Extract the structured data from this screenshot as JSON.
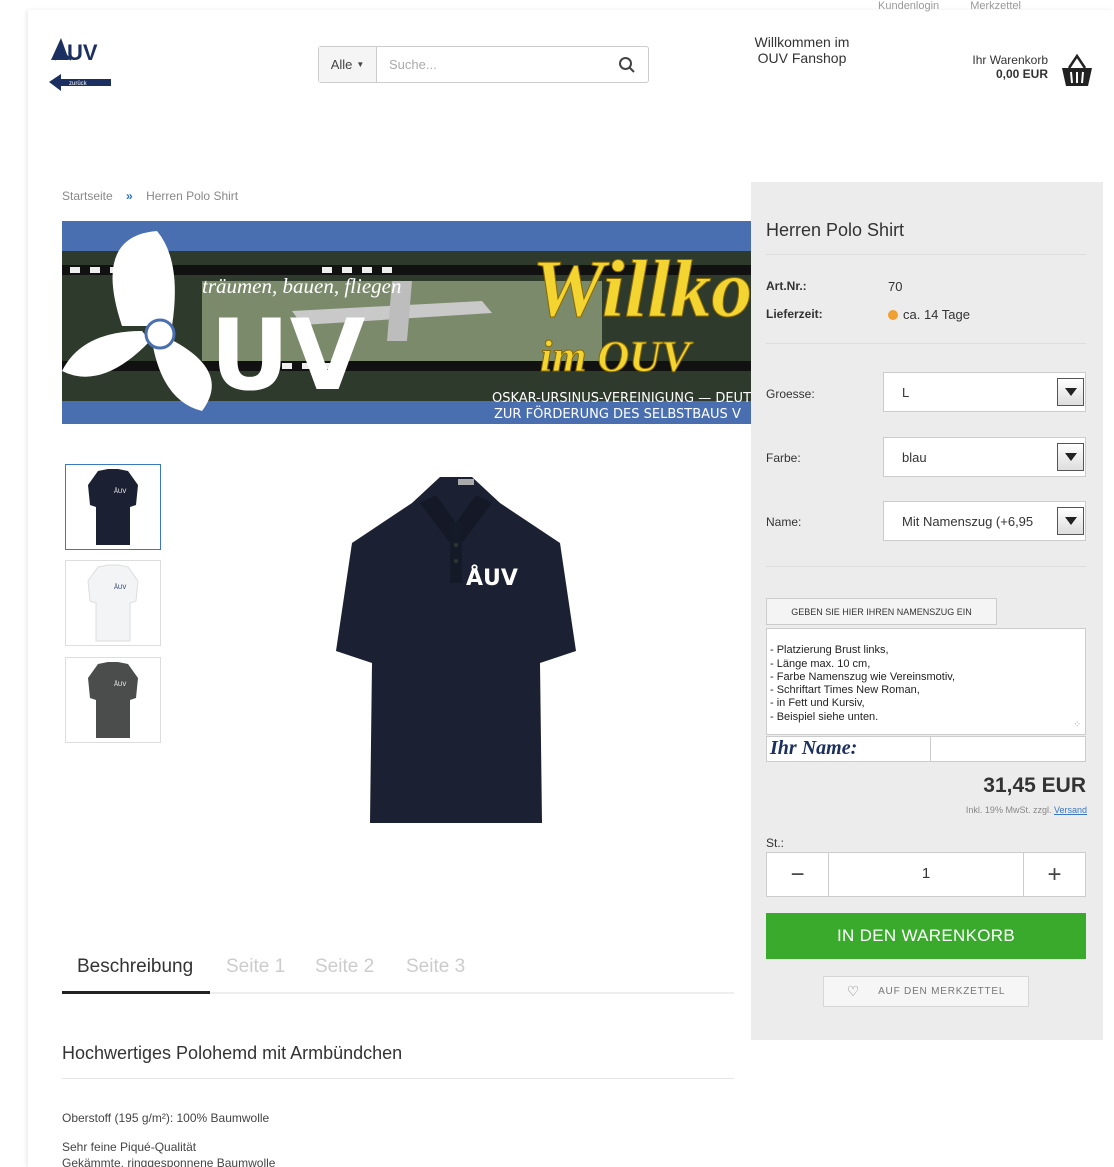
{
  "header": {
    "top_links": [
      "Kundenlogin",
      "Merkzettel"
    ],
    "search": {
      "category": "Alle",
      "placeholder": "Suche..."
    },
    "welcome": [
      "Willkommen im",
      "OUV Fanshop"
    ],
    "cart": {
      "label": "Ihr Warenkorb",
      "amount": "0,00 EUR"
    },
    "logo": {
      "text": "ÅUV",
      "back_label": "zurück"
    }
  },
  "breadcrumb": {
    "home": "Startseite",
    "separator": "»",
    "current": "Herren Polo Shirt"
  },
  "banner": {
    "slogan": "träumen, bauen, fliegen",
    "logo_text": "UV",
    "welcome_script": "Willko",
    "welcome_script2": "im OUV",
    "org_line1": "OSKAR-URSINUS-VEREINIGUNG — DEUT",
    "org_line2": "ZUR FÖRDERUNG DES SELBSTBAUS V"
  },
  "gallery": {
    "colors": [
      "#1b2132",
      "#f3f4f6",
      "#4b4d4c"
    ],
    "shirt_logo": "ÅUV"
  },
  "tabs": [
    "Beschreibung",
    "Seite 1",
    "Seite 2",
    "Seite 3"
  ],
  "description": {
    "title": "Hochwertiges Polohemd mit Armbündchen",
    "lines": [
      "Oberstoff (195 g/m²): 100% Baumwolle",
      "Sehr feine Piqué-Qualität",
      "Gekämmte, ringgesponnene Baumwolle"
    ]
  },
  "product": {
    "title": "Herren Polo Shirt",
    "artnr_label": "Art.Nr.:",
    "artnr": "70",
    "delivery_label": "Lieferzeit:",
    "delivery": "ca. 14 Tage",
    "options": [
      {
        "label": "Groesse:",
        "value": "L"
      },
      {
        "label": "Farbe:",
        "value": "blau"
      },
      {
        "label": "Name:",
        "value": "Mit Namenszug (+6,95"
      }
    ],
    "name_button": "GEBEN SIE HIER IHREN NAMENSZUG EIN",
    "name_text": "- Platzierung Brust links,\n- Länge max. 10 cm,\n- Farbe Namenszug wie Vereinsmotiv,\n- Schriftart Times New Roman,\n- in Fett und Kursiv,\n- Beispiel siehe unten.",
    "name_example": "Ihr Name:",
    "price": "31,45 EUR",
    "tax_text": "Inkl. 19% MwSt. zzgl.",
    "shipping_link": "Versand",
    "qty_label": "St.:",
    "qty": "1",
    "minus": "−",
    "plus": "+",
    "add_to_cart": "IN DEN WARENKORB",
    "wishlist": "AUF DEN MERKZETTEL"
  },
  "colors": {
    "accent_green": "#3aaa2d",
    "link_blue": "#3a78c2",
    "panel_gray": "#ececec"
  }
}
